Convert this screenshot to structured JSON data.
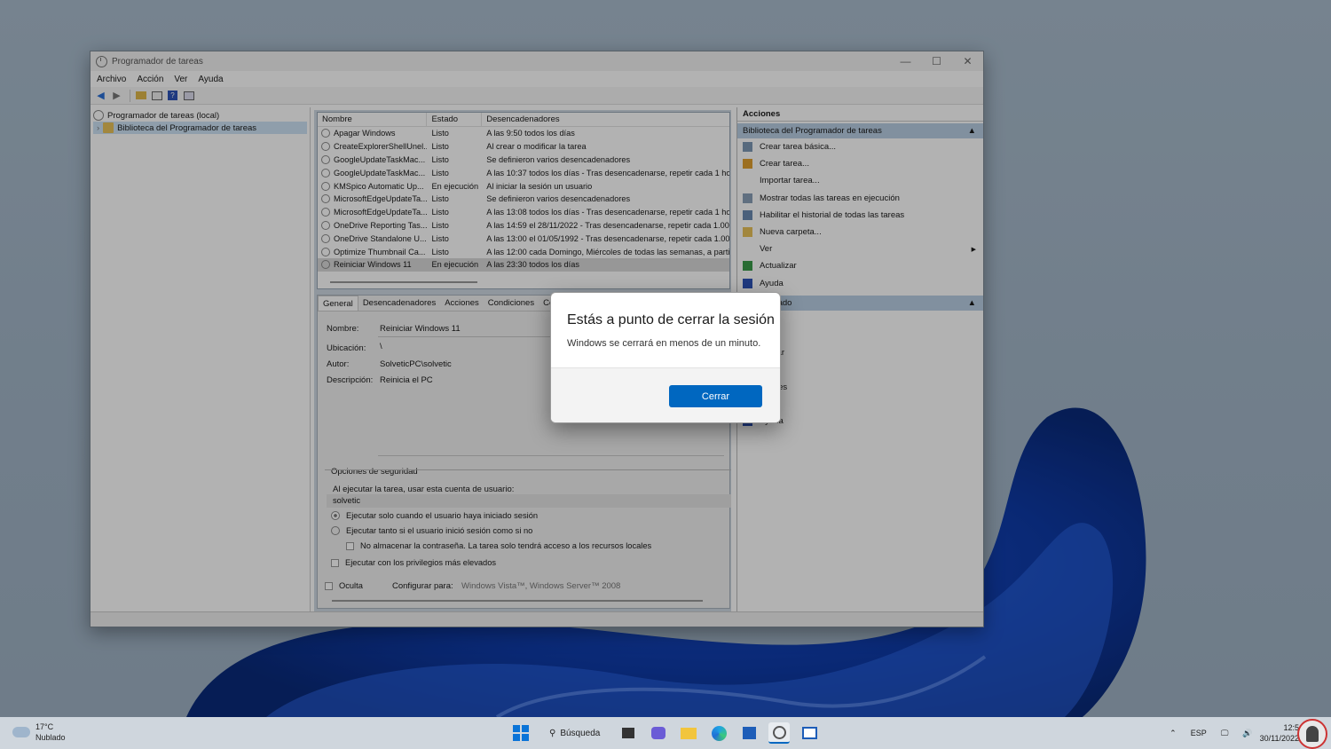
{
  "window": {
    "title": "Programador de tareas",
    "menu": [
      "Archivo",
      "Acción",
      "Ver",
      "Ayuda"
    ],
    "controls": {
      "minimize": "—",
      "maximize": "☐",
      "close": "✕"
    }
  },
  "tree": {
    "root": "Programador de tareas (local)",
    "child": "Biblioteca del Programador de tareas"
  },
  "tasklist": {
    "headers": [
      "Nombre",
      "Estado",
      "Desencadenadores"
    ],
    "rows": [
      [
        "Apagar Windows",
        "Listo",
        "A las 9:50 todos los días"
      ],
      [
        "CreateExplorerShellUnel...",
        "Listo",
        "Al crear o modificar la tarea"
      ],
      [
        "GoogleUpdateTaskMac...",
        "Listo",
        "Se definieron varios desencadenadores"
      ],
      [
        "GoogleUpdateTaskMac...",
        "Listo",
        "A las 10:37 todos los días - Tras desencadenarse, repetir cada 1 hora"
      ],
      [
        "KMSpico Automatic Up...",
        "En ejecución",
        "Al iniciar la sesión un usuario"
      ],
      [
        "MicrosoftEdgeUpdateTa...",
        "Listo",
        "Se definieron varios desencadenadores"
      ],
      [
        "MicrosoftEdgeUpdateTa...",
        "Listo",
        "A las 13:08 todos los días - Tras desencadenarse, repetir cada 1 hora"
      ],
      [
        "OneDrive Reporting Tas...",
        "Listo",
        "A las 14:59 el 28/11/2022 - Tras desencadenarse, repetir cada 1.00:00"
      ],
      [
        "OneDrive Standalone U...",
        "Listo",
        "A las 13:00 el 01/05/1992 - Tras desencadenarse, repetir cada 1.00:00"
      ],
      [
        "Optimize Thumbnail Ca...",
        "Listo",
        "A las 12:00 cada Domingo, Miércoles de todas las semanas, a partir"
      ],
      [
        "Reiniciar Windows 11",
        "En ejecución",
        "A las 23:30 todos los días"
      ]
    ]
  },
  "details": {
    "tabs": [
      "General",
      "Desencadenadores",
      "Acciones",
      "Condiciones",
      "Co"
    ],
    "nombre_label": "Nombre:",
    "nombre_value": "Reiniciar Windows 11",
    "ubicacion_label": "Ubicación:",
    "ubicacion_value": "\\",
    "autor_label": "Autor:",
    "autor_value": "SolveticPC\\solvetic",
    "descripcion_label": "Descripción:",
    "descripcion_value": "Reinicia el PC",
    "security_title": "Opciones de seguridad",
    "security_account_label": "Al ejecutar la tarea, usar esta cuenta de usuario:",
    "security_account": "solvetic",
    "opt_only_logged": "Ejecutar solo cuando el usuario haya iniciado sesión",
    "opt_whether_logged": "Ejecutar tanto si el usuario inició sesión como si no",
    "opt_no_store_password": "No almacenar la contraseña. La tarea solo tendrá acceso a los recursos locales",
    "opt_highest_privileges": "Ejecutar con los privilegios más elevados",
    "hidden_label": "Oculta",
    "configure_label": "Configurar para:",
    "configure_value": "Windows Vista™, Windows Server™ 2008"
  },
  "actions": {
    "title": "Acciones",
    "group1": "Biblioteca del Programador de tareas",
    "group1_items": [
      "Crear tarea básica...",
      "Crear tarea...",
      "Importar tarea...",
      "Mostrar todas las tareas en ejecución",
      "Habilitar el historial de todas las tareas",
      "Nueva carpeta...",
      "Ver",
      "Actualizar",
      "Ayuda"
    ],
    "group2": "seleccionado",
    "group2_items": [
      "tar",
      "zar",
      "abilitar",
      "rtar...",
      "edades",
      "nar",
      "Ayuda"
    ]
  },
  "dialog": {
    "title": "Estás a punto de cerrar la sesión",
    "message": "Windows se cerrará en menos de un minuto.",
    "button": "Cerrar",
    "accent": "#0067c0"
  },
  "taskbar": {
    "weather_temp": "17°C",
    "weather_desc": "Nublado",
    "search": "Búsqueda",
    "lang": "ESP",
    "time": "12:5",
    "date": "30/11/2022"
  }
}
